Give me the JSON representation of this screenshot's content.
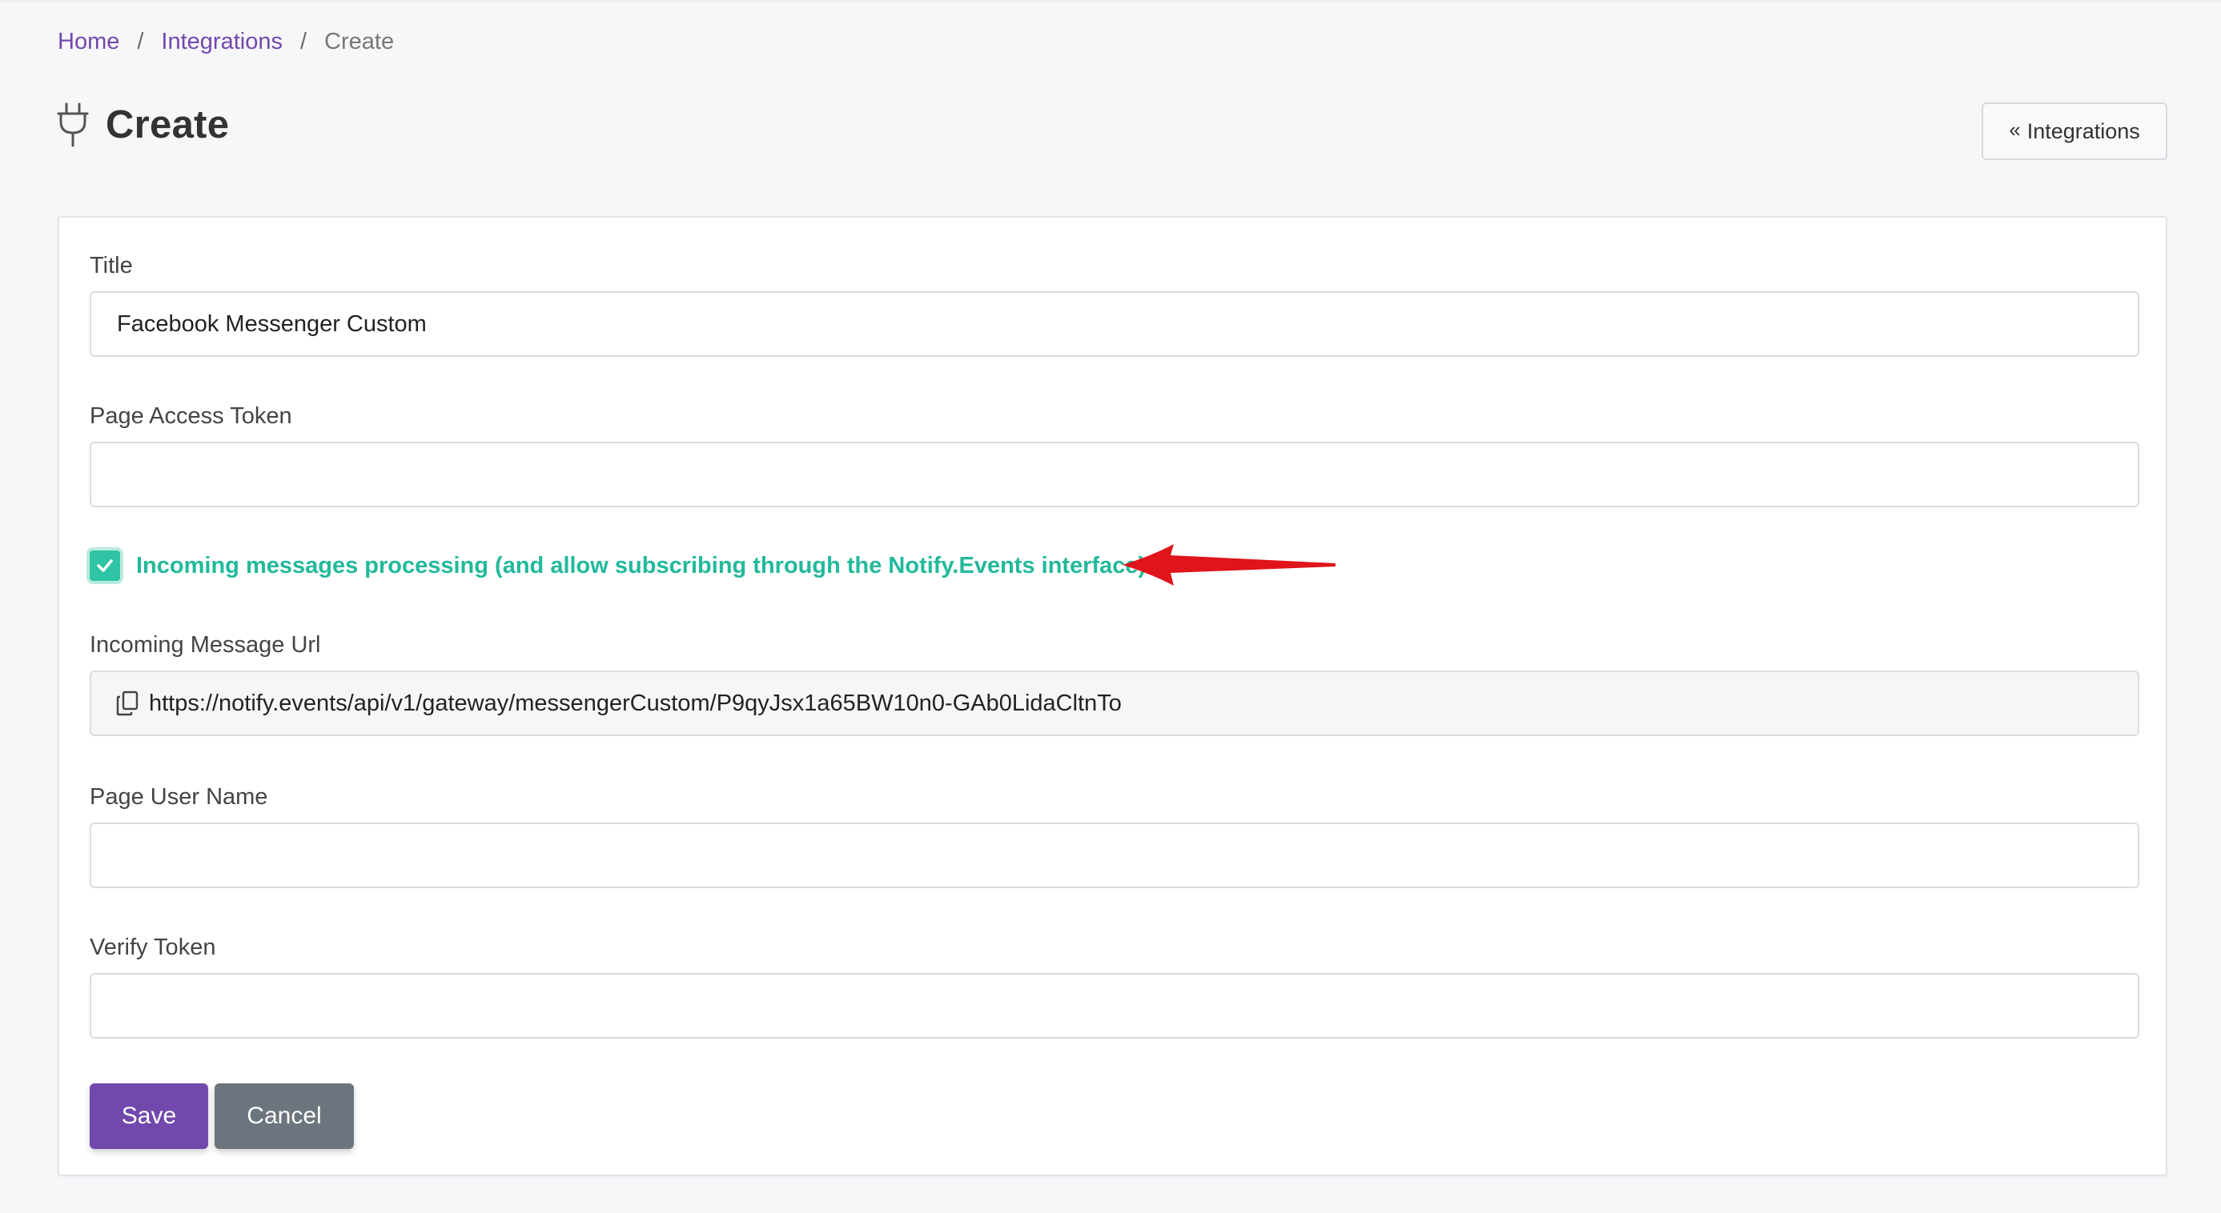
{
  "breadcrumb": {
    "items": [
      "Home",
      "Integrations"
    ],
    "current": "Create",
    "separator": "/"
  },
  "header": {
    "title": "Create",
    "icon": "plug-icon",
    "back_button_label": "Integrations",
    "back_button_icon": "double-chevron-left-icon"
  },
  "form": {
    "title": {
      "label": "Title",
      "value": "Facebook Messenger Custom"
    },
    "page_access_token": {
      "label": "Page Access Token",
      "value": ""
    },
    "incoming_processing": {
      "label": "Incoming messages processing (and allow subscribing through the Notify.Events interface)",
      "checked": true
    },
    "incoming_message_url": {
      "label": "Incoming Message Url",
      "value": "https://notify.events/api/v1/gateway/messengerCustom/P9qyJsx1a65BW10n0-GAb0LidaCltnTo",
      "icon": "copy-icon"
    },
    "page_user_name": {
      "label": "Page User Name",
      "value": ""
    },
    "verify_token": {
      "label": "Verify Token",
      "value": ""
    },
    "save_label": "Save",
    "cancel_label": "Cancel"
  },
  "colors": {
    "accent": "#7248ad",
    "checkbox": "#2ec4a5",
    "check_label": "#22b99b",
    "annotation_arrow": "#e0141b",
    "cancel": "#6c757d"
  }
}
